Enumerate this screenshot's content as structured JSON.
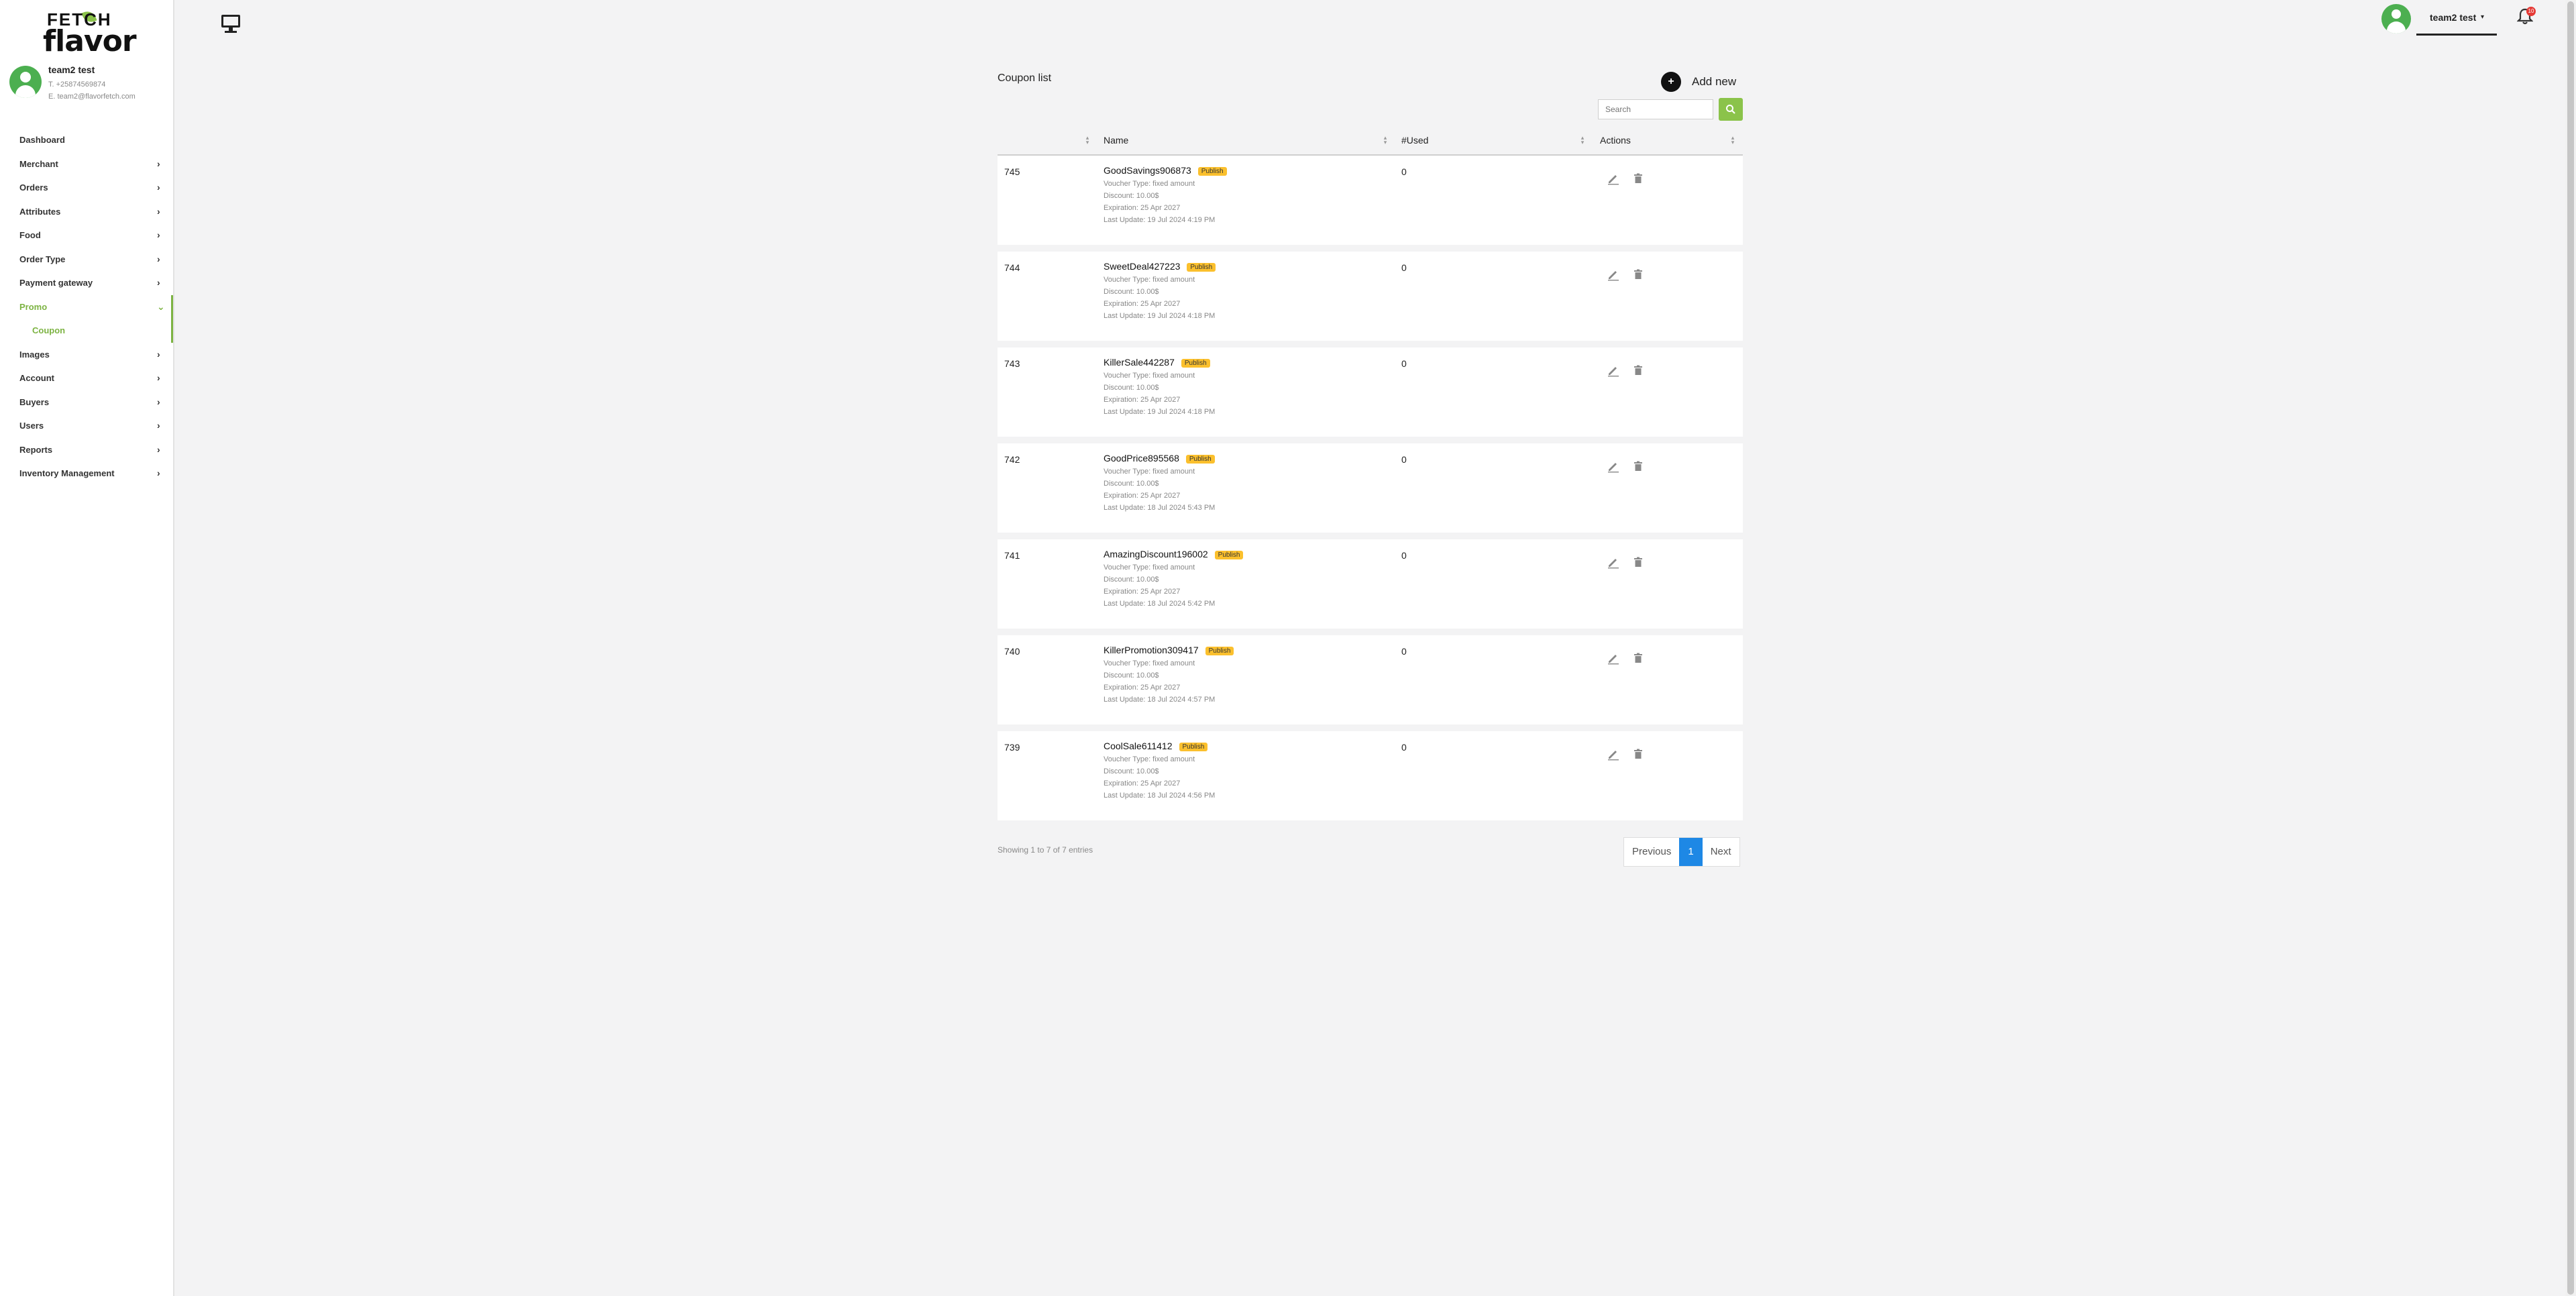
{
  "brand": {
    "line1": "FETCH",
    "line2": "flavor"
  },
  "profile": {
    "name": "team2 test",
    "phone": "T. +25874569874",
    "email": "E. team2@flavorfetch.com"
  },
  "sidebar": {
    "items": [
      {
        "label": "Dashboard",
        "chevron": ""
      },
      {
        "label": "Merchant",
        "chevron": "›"
      },
      {
        "label": "Orders",
        "chevron": "›"
      },
      {
        "label": "Attributes",
        "chevron": "›"
      },
      {
        "label": "Food",
        "chevron": "›"
      },
      {
        "label": "Order Type",
        "chevron": "›"
      },
      {
        "label": "Payment gateway",
        "chevron": "›"
      },
      {
        "label": "Promo",
        "chevron": "⌄"
      },
      {
        "label": "Images",
        "chevron": "›"
      },
      {
        "label": "Account",
        "chevron": "›"
      },
      {
        "label": "Buyers",
        "chevron": "›"
      },
      {
        "label": "Users",
        "chevron": "›"
      },
      {
        "label": "Reports",
        "chevron": "›"
      },
      {
        "label": "Inventory Management",
        "chevron": "›"
      }
    ],
    "sub_items": [
      {
        "label": "Coupon"
      }
    ]
  },
  "topbar": {
    "username": "team2 test",
    "caret": "▾",
    "notification_count": "10"
  },
  "main": {
    "title": "Coupon list",
    "add_new_icon": "+",
    "add_new_label": "Add new",
    "search_placeholder": "Search"
  },
  "table": {
    "headers": {
      "id": "",
      "name": "Name",
      "used": "#Used",
      "actions": "Actions"
    },
    "rows": [
      {
        "id": "745",
        "name": "GoodSavings906873",
        "status": "Publish",
        "voucher_type": "Voucher Type: fixed amount",
        "discount": "Discount: 10.00$",
        "expiration": "Expiration: 25 Apr 2027",
        "last_update": "Last Update: 19 Jul 2024 4:19 PM",
        "used": "0"
      },
      {
        "id": "744",
        "name": "SweetDeal427223",
        "status": "Publish",
        "voucher_type": "Voucher Type: fixed amount",
        "discount": "Discount: 10.00$",
        "expiration": "Expiration: 25 Apr 2027",
        "last_update": "Last Update: 19 Jul 2024 4:18 PM",
        "used": "0"
      },
      {
        "id": "743",
        "name": "KillerSale442287",
        "status": "Publish",
        "voucher_type": "Voucher Type: fixed amount",
        "discount": "Discount: 10.00$",
        "expiration": "Expiration: 25 Apr 2027",
        "last_update": "Last Update: 19 Jul 2024 4:18 PM",
        "used": "0"
      },
      {
        "id": "742",
        "name": "GoodPrice895568",
        "status": "Publish",
        "voucher_type": "Voucher Type: fixed amount",
        "discount": "Discount: 10.00$",
        "expiration": "Expiration: 25 Apr 2027",
        "last_update": "Last Update: 18 Jul 2024 5:43 PM",
        "used": "0"
      },
      {
        "id": "741",
        "name": "AmazingDiscount196002",
        "status": "Publish",
        "voucher_type": "Voucher Type: fixed amount",
        "discount": "Discount: 10.00$",
        "expiration": "Expiration: 25 Apr 2027",
        "last_update": "Last Update: 18 Jul 2024 5:42 PM",
        "used": "0"
      },
      {
        "id": "740",
        "name": "KillerPromotion309417",
        "status": "Publish",
        "voucher_type": "Voucher Type: fixed amount",
        "discount": "Discount: 10.00$",
        "expiration": "Expiration: 25 Apr 2027",
        "last_update": "Last Update: 18 Jul 2024 4:57 PM",
        "used": "0"
      },
      {
        "id": "739",
        "name": "CoolSale611412",
        "status": "Publish",
        "voucher_type": "Voucher Type: fixed amount",
        "discount": "Discount: 10.00$",
        "expiration": "Expiration: 25 Apr 2027",
        "last_update": "Last Update: 18 Jul 2024 4:56 PM",
        "used": "0"
      }
    ]
  },
  "footer": {
    "showing": "Showing 1 to 7 of 7 entries",
    "pagination": {
      "previous": "Previous",
      "current": "1",
      "next": "Next"
    }
  },
  "colors": {
    "accent_green": "#8bc34a",
    "active_nav": "#7cb342",
    "status_badge": "#fbc02d",
    "page_current": "#1e88e5",
    "notification": "#e53935"
  },
  "icons": {
    "monitor": "monitor-icon",
    "bell": "bell-icon",
    "search": "search-icon",
    "edit": "pencil-icon",
    "delete": "trash-icon",
    "sort": "sort-icon"
  }
}
